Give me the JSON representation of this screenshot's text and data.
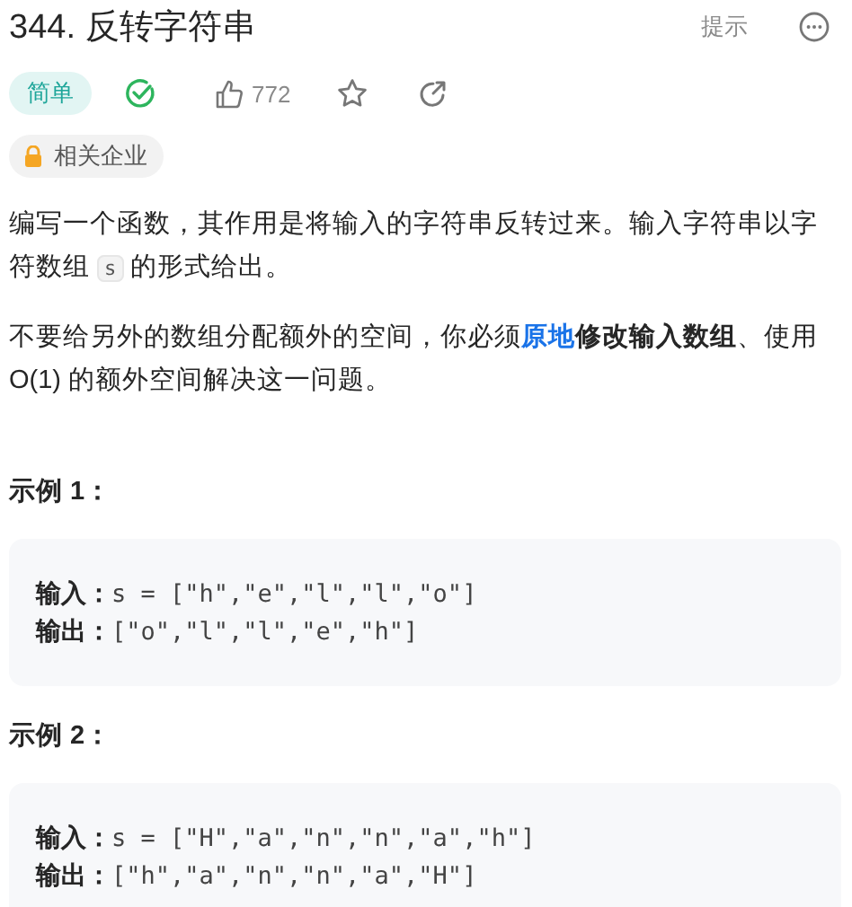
{
  "title": "344. 反转字符串",
  "hint_button": "提示",
  "meta": {
    "difficulty": "简单",
    "solved": true,
    "likes": "772",
    "starred": false
  },
  "company_tag": "相关企业",
  "paragraphs": [
    [
      {
        "kind": "text",
        "text": "编写一个函数，其作用是将输入的字符串反转过来。输入字符串以字符数组 "
      },
      {
        "kind": "code",
        "text": "s"
      },
      {
        "kind": "text",
        "text": " 的形式给出。"
      }
    ],
    [
      {
        "kind": "text",
        "text": "不要给另外的数组分配额外的空间，你必须"
      },
      {
        "kind": "link",
        "text": "原地"
      },
      {
        "kind": "bold",
        "text": "修改输入数组"
      },
      {
        "kind": "text",
        "text": "、使用 O(1) 的额外空间解决这一问题。"
      }
    ]
  ],
  "examples": [
    {
      "heading": "示例 1：",
      "lines": [
        {
          "label": "输入：",
          "value": "s = [\"h\",\"e\",\"l\",\"l\",\"o\"]"
        },
        {
          "label": "输出：",
          "value": "[\"o\",\"l\",\"l\",\"e\",\"h\"]"
        }
      ]
    },
    {
      "heading": "示例 2：",
      "lines": [
        {
          "label": "输入：",
          "value": "s = [\"H\",\"a\",\"n\",\"n\",\"a\",\"h\"]"
        },
        {
          "label": "输出：",
          "value": "[\"h\",\"a\",\"n\",\"n\",\"a\",\"H\"]"
        }
      ]
    }
  ]
}
